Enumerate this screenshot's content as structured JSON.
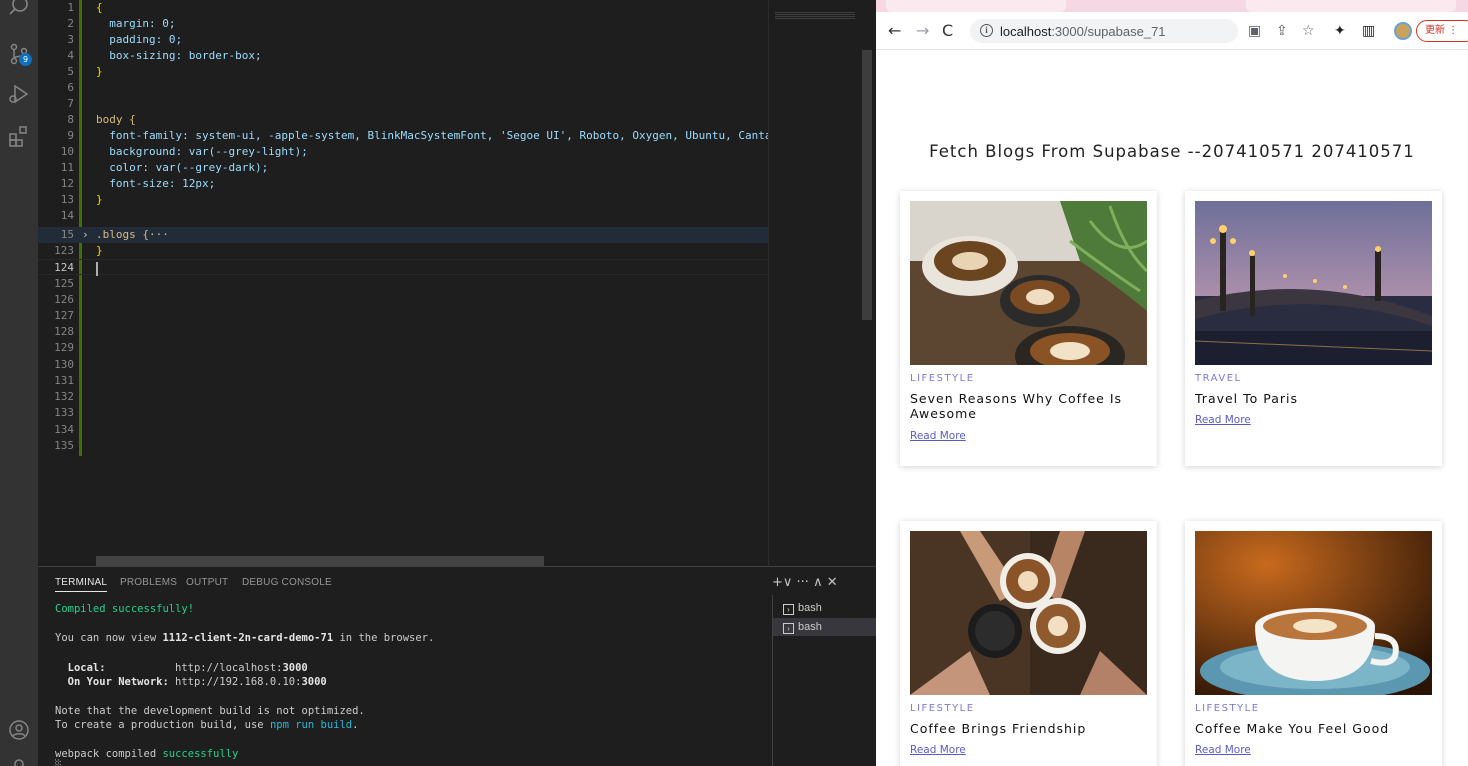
{
  "vscode": {
    "activity_badge": "9",
    "lines": [
      {
        "n": "1",
        "code": "{"
      },
      {
        "n": "2",
        "code": "  margin: 0;"
      },
      {
        "n": "3",
        "code": "  padding: 0;"
      },
      {
        "n": "4",
        "code": "  box-sizing: border-box;"
      },
      {
        "n": "5",
        "code": "}"
      },
      {
        "n": "6",
        "code": ""
      },
      {
        "n": "7",
        "code": ""
      },
      {
        "n": "8",
        "code": "body {"
      },
      {
        "n": "9",
        "code": "  font-family: system-ui, -apple-system, BlinkMacSystemFont, 'Segoe UI', Roboto, Oxygen, Ubuntu, Canta"
      },
      {
        "n": "10",
        "code": "  background: var(--grey-light);"
      },
      {
        "n": "11",
        "code": "  color: var(--grey-dark);"
      },
      {
        "n": "12",
        "code": "  font-size: 12px;"
      },
      {
        "n": "13",
        "code": "}"
      },
      {
        "n": "14",
        "code": ""
      },
      {
        "n": "15",
        "code": ".blogs {···"
      },
      {
        "n": "123",
        "code": "}"
      },
      {
        "n": "124",
        "code": ""
      },
      {
        "n": "125",
        "code": ""
      },
      {
        "n": "126",
        "code": ""
      },
      {
        "n": "127",
        "code": ""
      },
      {
        "n": "128",
        "code": ""
      },
      {
        "n": "129",
        "code": ""
      },
      {
        "n": "130",
        "code": ""
      },
      {
        "n": "131",
        "code": ""
      },
      {
        "n": "132",
        "code": ""
      },
      {
        "n": "133",
        "code": ""
      },
      {
        "n": "134",
        "code": ""
      },
      {
        "n": "135",
        "code": ""
      }
    ],
    "panel_tabs": [
      "TERMINAL",
      "PROBLEMS",
      "OUTPUT",
      "DEBUG CONSOLE"
    ],
    "panel_actions": "+∨ ··· ∧ ✕",
    "terminal": {
      "compiled": "Compiled successfully!",
      "view_prefix": "You can now view ",
      "app_name": "1112-client-2n-card-demo-71",
      "view_suffix": " in the browser.",
      "local_label": "  Local:",
      "local_url_prefix": "http://localhost:",
      "local_port": "3000",
      "network_label": "  On Your Network:",
      "network_url_prefix": "http://192.168.0.10:",
      "network_port": "3000",
      "note1": "Note that the development build is not optimized.",
      "note2_prefix": "To create a production build, use ",
      "note2_cmd": "npm run build",
      "note2_suffix": ".",
      "webpack_prefix": "webpack compiled ",
      "webpack_status": "successfully",
      "prompt": "░"
    },
    "terminals": [
      "bash",
      "bash"
    ]
  },
  "browser": {
    "url_host": "localhost",
    "url_path": ":3000/supabase_71",
    "update_label": "更新 ⋮",
    "page_title": "Fetch Blogs From Supabase --207410571 207410571",
    "cards": [
      {
        "category": "LIFESTYLE",
        "title": "Seven Reasons Why Coffee Is Awesome",
        "link": "Read More"
      },
      {
        "category": "TRAVEL",
        "title": "Travel To Paris",
        "link": "Read More"
      },
      {
        "category": "LIFESTYLE",
        "title": "Coffee Brings Friendship",
        "link": "Read More"
      },
      {
        "category": "LIFESTYLE",
        "title": "Coffee Make You Feel Good",
        "link": "Read More"
      }
    ]
  }
}
